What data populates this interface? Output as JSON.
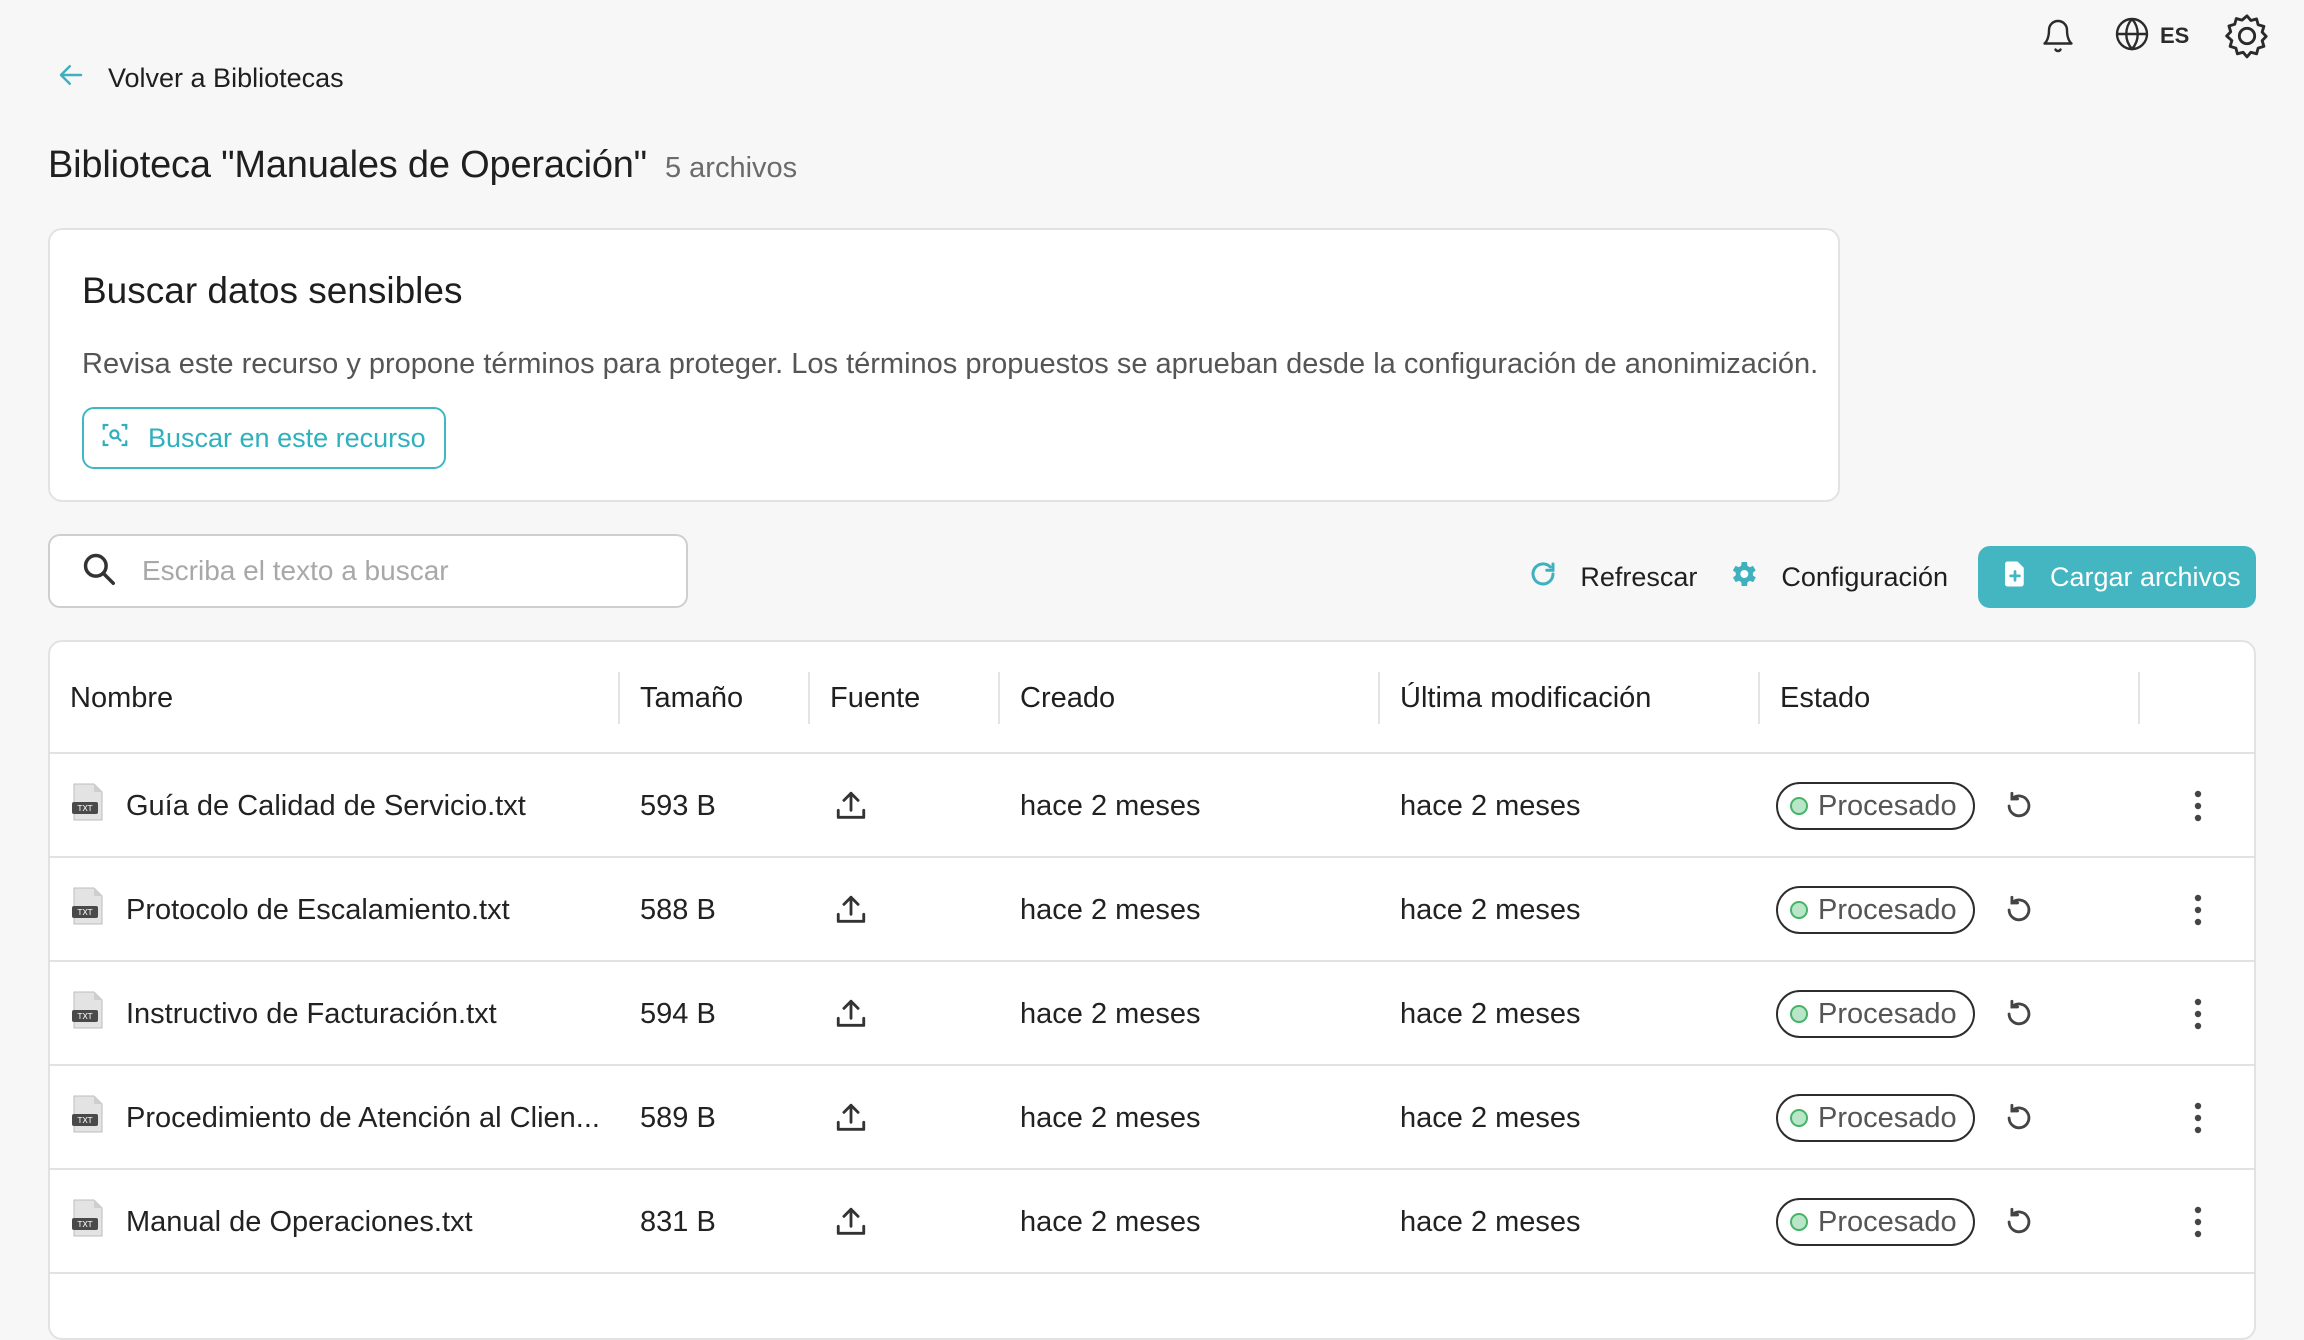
{
  "topbar": {
    "language": "ES"
  },
  "nav": {
    "back_label": "Volver a Bibliotecas"
  },
  "page": {
    "title": "Biblioteca \"Manuales de Operación\"",
    "file_count": "5 archivos"
  },
  "sensitive_card": {
    "title": "Buscar datos sensibles",
    "description": "Revisa este recurso y propone términos para proteger. Los términos propuestos se aprueban desde la configuración de anonimización.",
    "button_label": "Buscar en este recurso"
  },
  "search": {
    "placeholder": "Escriba el texto a buscar",
    "value": ""
  },
  "toolbar": {
    "refresh_label": "Refrescar",
    "config_label": "Configuración",
    "upload_label": "Cargar archivos"
  },
  "table": {
    "columns": [
      "Nombre",
      "Tamaño",
      "Fuente",
      "Creado",
      "Última modificación",
      "Estado"
    ],
    "rows": [
      {
        "name": "Guía de Calidad de Servicio.txt",
        "size": "593 B",
        "created": "hace 2 meses",
        "modified": "hace 2 meses",
        "status": "Procesado"
      },
      {
        "name": "Protocolo de Escalamiento.txt",
        "size": "588 B",
        "created": "hace 2 meses",
        "modified": "hace 2 meses",
        "status": "Procesado"
      },
      {
        "name": "Instructivo de Facturación.txt",
        "size": "594 B",
        "created": "hace 2 meses",
        "modified": "hace 2 meses",
        "status": "Procesado"
      },
      {
        "name": "Procedimiento de Atención al Clien...",
        "size": "589 B",
        "created": "hace 2 meses",
        "modified": "hace 2 meses",
        "status": "Procesado"
      },
      {
        "name": "Manual de Operaciones.txt",
        "size": "831 B",
        "created": "hace 2 meses",
        "modified": "hace 2 meses",
        "status": "Procesado"
      }
    ],
    "file_type_badge": "TXT"
  },
  "colors": {
    "accent": "#43b6c2",
    "status_ok": "#44b46a",
    "background": "#f7f7f7"
  },
  "icons": {
    "back": "arrow-left-icon",
    "bell": "bell-icon",
    "globe": "globe-icon",
    "settings": "gear-icon",
    "scan": "scan-icon",
    "search": "search-icon",
    "refresh": "refresh-icon",
    "config": "gear-icon",
    "upload_file": "file-plus-icon",
    "source": "upload-icon",
    "reprocess": "rotate-ccw-icon",
    "more": "kebab-menu-icon"
  }
}
